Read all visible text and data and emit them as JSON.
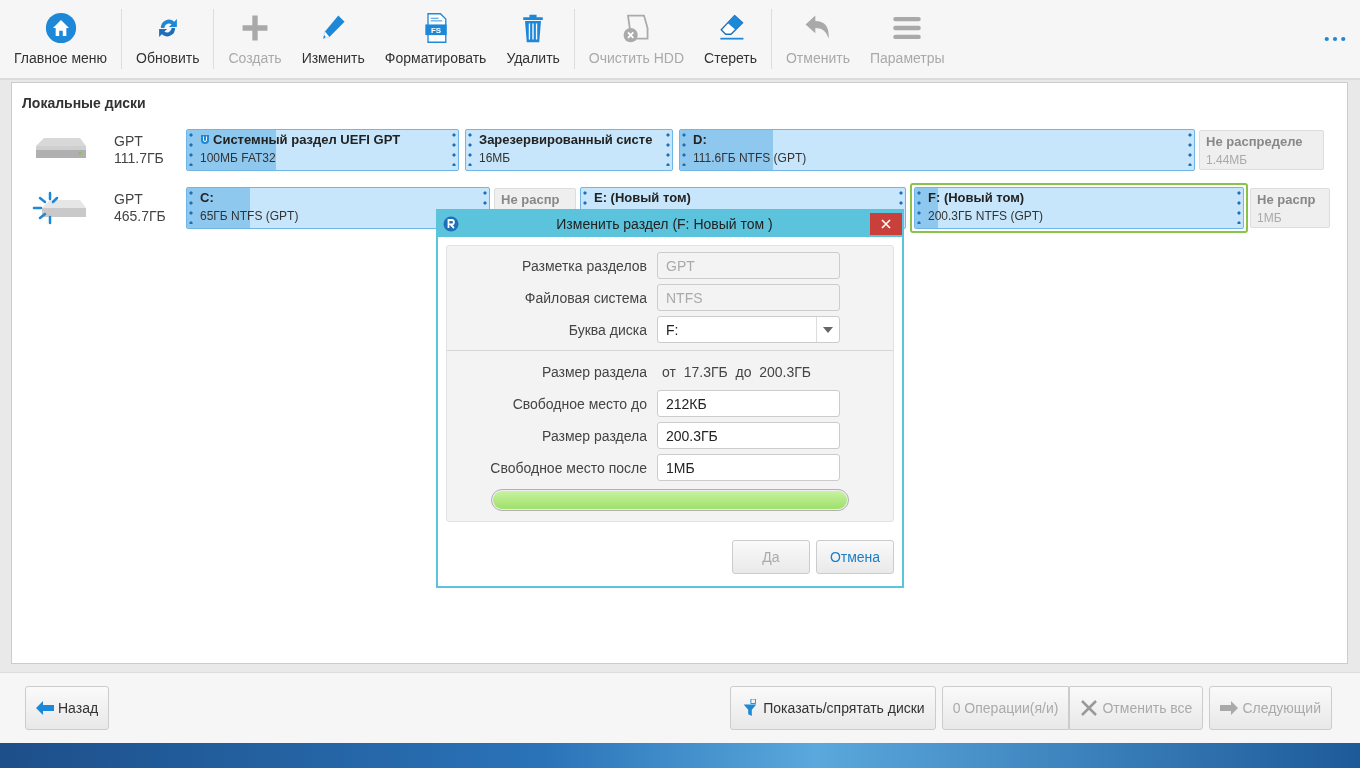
{
  "toolbar": [
    {
      "label": "Главное меню",
      "disabled": false
    },
    {
      "label": "Обновить",
      "disabled": false
    },
    {
      "label": "Создать",
      "disabled": true
    },
    {
      "label": "Изменить",
      "disabled": false
    },
    {
      "label": "Форматировать",
      "disabled": false,
      "badge": "FS"
    },
    {
      "label": "Удалить",
      "disabled": false
    },
    {
      "label": "Очистить HDD",
      "disabled": true
    },
    {
      "label": "Стереть",
      "disabled": false
    },
    {
      "label": "Отменить",
      "disabled": true
    },
    {
      "label": "Параметры",
      "disabled": true
    }
  ],
  "panel_title": "Локальные диски",
  "disks": [
    {
      "style": "GPT",
      "size": "111.7ГБ",
      "partitions": [
        {
          "kind": "partition",
          "name": "Системный раздел UEFI GPT",
          "detail": "100МБ FAT32",
          "level": 0.33,
          "selected": false,
          "shield": true
        },
        {
          "kind": "partition",
          "name": "Зарезервированный систе",
          "detail": "16МБ",
          "selected": false,
          "shield": false
        },
        {
          "kind": "partition",
          "name": "D:",
          "detail": "111.6ГБ NTFS (GPT)",
          "level": 0.18,
          "selected": false,
          "shield": false
        },
        {
          "kind": "unallocated",
          "name": "Не распределе",
          "detail": "1.44МБ"
        }
      ]
    },
    {
      "style": "GPT",
      "size": "465.7ГБ",
      "partitions": [
        {
          "kind": "partition",
          "name": "C:",
          "detail": "65ГБ NTFS (GPT)",
          "level": 0.21,
          "selected": false,
          "shield": false
        },
        {
          "kind": "unallocated",
          "name": "Не распр"
        },
        {
          "kind": "partition",
          "name": "E: (Новый том)",
          "selected": false,
          "shield": false
        },
        {
          "kind": "partition",
          "name": "F: (Новый том)",
          "detail": "200.3ГБ NTFS (GPT)",
          "level": 0.07,
          "selected": true,
          "shield": false
        },
        {
          "kind": "unallocated",
          "name": "Не распр",
          "detail": "1МБ"
        }
      ]
    }
  ],
  "dialog": {
    "title": "Изменить раздел (F: Новый том )",
    "fields": [
      {
        "kind": "input",
        "label": "Разметка разделов",
        "value": "GPT",
        "disabled": true
      },
      {
        "kind": "input",
        "label": "Файловая система",
        "value": "NTFS",
        "disabled": true
      },
      {
        "kind": "select",
        "label": "Буква диска",
        "value": "F:",
        "disabled": false
      }
    ],
    "size_range": {
      "label": "Размер раздела",
      "from_word": "от",
      "from": "17.3ГБ",
      "to_word": "до",
      "to": "200.3ГБ"
    },
    "size_fields": [
      {
        "label": "Свободное место до",
        "value": "212КБ"
      },
      {
        "label": "Размер раздела",
        "value": "200.3ГБ"
      },
      {
        "label": "Свободное место после",
        "value": "1МБ"
      }
    ],
    "slider": {
      "level": 1
    },
    "buttons": [
      {
        "label": "Да",
        "disabled": true
      },
      {
        "label": "Отмена",
        "disabled": false
      }
    ]
  },
  "footer": {
    "back": {
      "label": "Назад",
      "disabled": false
    },
    "buttons": [
      {
        "label": "Показать/спрятать диски",
        "disabled": false
      },
      {
        "label": "0 Операции(я/и)",
        "disabled": true
      },
      {
        "label": "Отменить все",
        "disabled": true
      },
      {
        "label": "Следующий",
        "disabled": true
      }
    ]
  }
}
